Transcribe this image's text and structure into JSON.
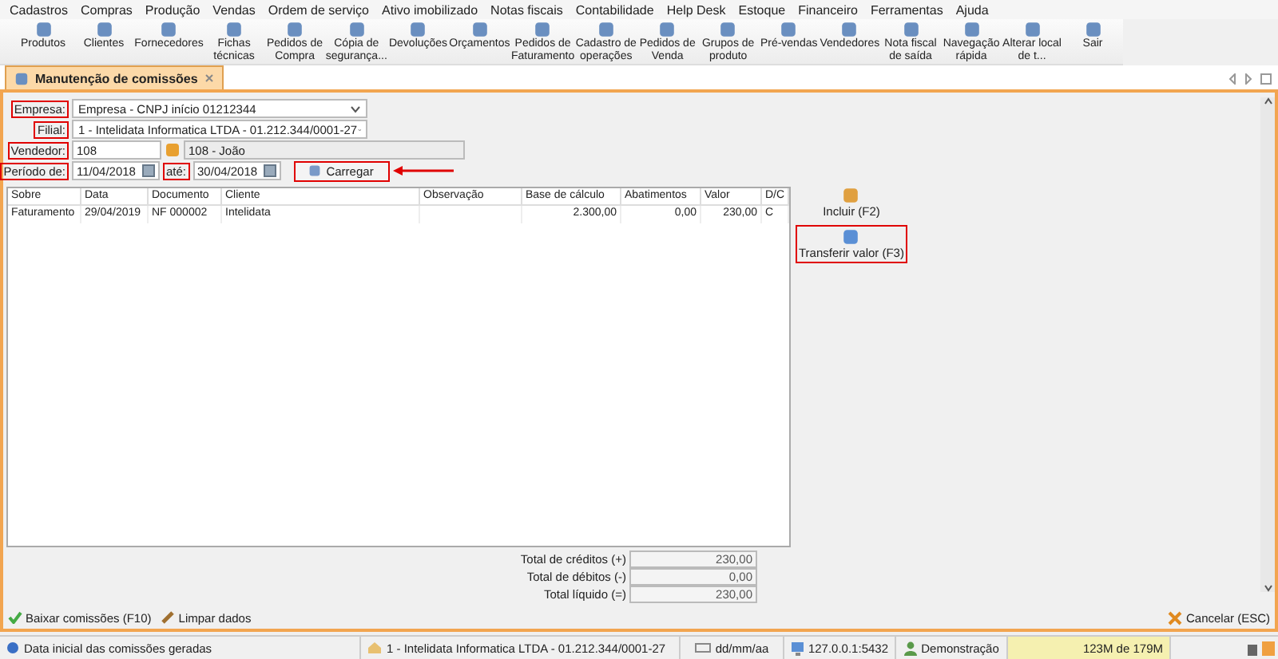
{
  "menu": [
    "Cadastros",
    "Compras",
    "Produção",
    "Vendas",
    "Ordem de serviço",
    "Ativo imobilizado",
    "Notas fiscais",
    "Contabilidade",
    "Help Desk",
    "Estoque",
    "Financeiro",
    "Ferramentas",
    "Ajuda"
  ],
  "toolbar": [
    {
      "label": "Produtos"
    },
    {
      "label": "Clientes"
    },
    {
      "label": "Fornecedores"
    },
    {
      "label": "Fichas\ntécnicas"
    },
    {
      "label": "Pedidos de\nCompra"
    },
    {
      "label": "Cópia de\nsegurança..."
    },
    {
      "label": "Devoluções"
    },
    {
      "label": "Orçamentos"
    },
    {
      "label": "Pedidos de\nFaturamento"
    },
    {
      "label": "Cadastro de\noperações"
    },
    {
      "label": "Pedidos de\nVenda"
    },
    {
      "label": "Grupos de\nproduto"
    },
    {
      "label": "Pré-vendas"
    },
    {
      "label": "Vendedores"
    },
    {
      "label": "Nota fiscal\nde saída"
    },
    {
      "label": "Navegação\nrápida"
    },
    {
      "label": "Alterar local\nde t..."
    },
    {
      "label": "Sair"
    }
  ],
  "tab": {
    "label": "Manutenção de comissões",
    "selected": true
  },
  "form": {
    "empresa": {
      "label": "Empresa:",
      "value": "Empresa - CNPJ início 01212344",
      "highlighted": true
    },
    "filial": {
      "label": "Filial:",
      "value": "1 - Intelidata Informatica LTDA - 01.212.344/0001-27",
      "highlighted": true
    },
    "vendedor": {
      "label": "Vendedor:",
      "value": "108",
      "name": "108 - João",
      "highlighted": true
    },
    "periodo": {
      "label": "Período de:",
      "from": "11/04/2018",
      "to_label": "até:",
      "to": "30/04/2018",
      "highlighted": true,
      "to_highlighted": true
    },
    "load_button": {
      "label": "Carregar",
      "highlighted": true
    }
  },
  "table": {
    "columns": [
      "Sobre",
      "Data",
      "Documento",
      "Cliente",
      "Observação",
      "Base de cálculo",
      "Abatimentos",
      "Valor",
      "D/C"
    ],
    "rows": [
      [
        "Faturamento",
        "29/04/2019",
        "NF 000002",
        "Intelidata",
        "",
        "2.300,00",
        "0,00",
        "230,00",
        "C"
      ]
    ]
  },
  "actions": [
    {
      "label": "Incluir (F2)",
      "highlighted": false
    },
    {
      "label": "Transferir valor (F3)",
      "highlighted": true
    }
  ],
  "totals": [
    {
      "label": "Total de créditos (+)",
      "value": "230,00"
    },
    {
      "label": "Total de débitos (-)",
      "value": "0,00"
    },
    {
      "label": "Total líquido (=)",
      "value": "230,00"
    }
  ],
  "footer_buttons": [
    "Baixar comissões (F10)",
    "Limpar dados"
  ],
  "cancel_button": "Cancelar (ESC)",
  "status_bar": {
    "hint": "Data inicial das comissões geradas",
    "company": "1 - Intelidata Informatica LTDA - 01.212.344/0001-27",
    "date_format": "dd/mm/aa",
    "server": "127.0.0.1:5432",
    "user": "Demonstração",
    "memory": "123M de 179M"
  }
}
